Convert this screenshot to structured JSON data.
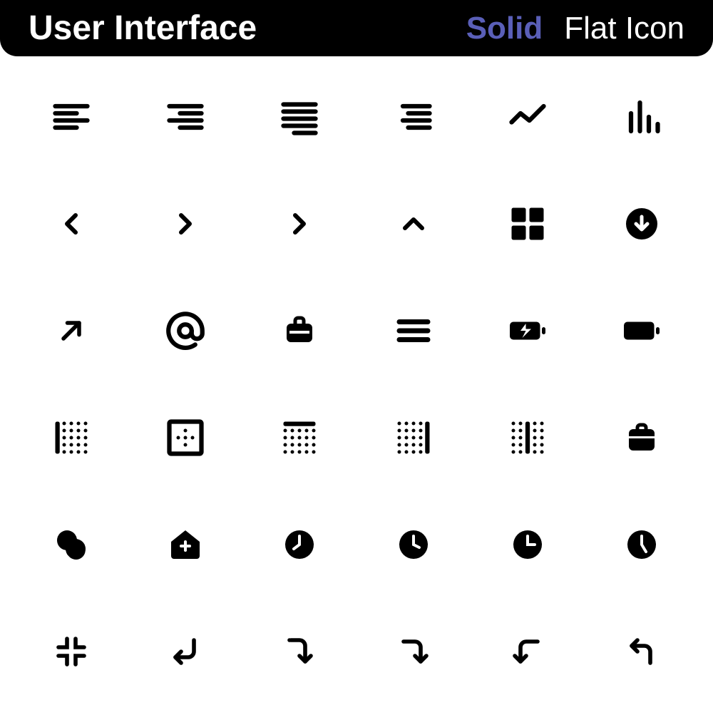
{
  "header": {
    "title": "User Interface",
    "solid": "Solid",
    "flat": "Flat Icon"
  },
  "icons": [
    [
      "align-left",
      "align-right",
      "align-justify",
      "align-center",
      "analytics-line",
      "bar-chart"
    ],
    [
      "chevron-left",
      "chevron-right",
      "chevron-right-2",
      "chevron-up",
      "grid-apps",
      "arrow-down-circle"
    ],
    [
      "arrow-up-right",
      "at-sign",
      "briefcase-outline",
      "menu-hamburger",
      "battery-charging",
      "battery-full"
    ],
    [
      "border-left",
      "border-box",
      "border-top",
      "border-right",
      "border-center-vertical",
      "briefcase-solid"
    ],
    [
      "coins",
      "home-add",
      "clock-1",
      "clock-2",
      "clock-3",
      "clock-4"
    ],
    [
      "minimize",
      "corner-down-left",
      "corner-right-down",
      "corner-down-right",
      "corner-left-down",
      "corner-up-left"
    ]
  ]
}
